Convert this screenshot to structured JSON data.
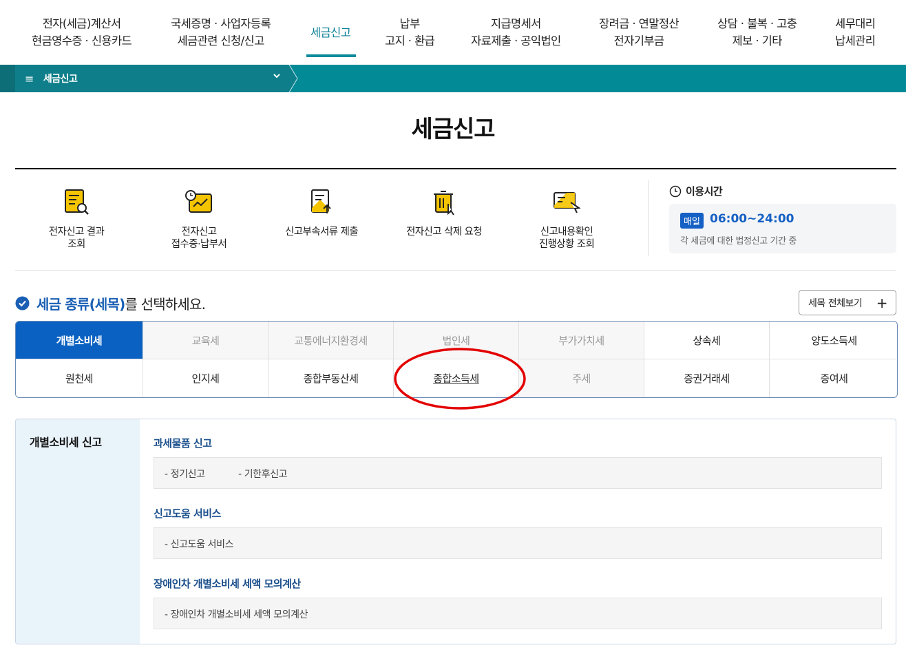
{
  "nav": [
    {
      "line1": "전자(세금)계산서",
      "line2": "현금영수증 · 신용카드"
    },
    {
      "line1": "국세증명 · 사업자등록",
      "line2": "세금관련 신청/신고"
    },
    {
      "line1": "세금신고",
      "line2": ""
    },
    {
      "line1": "납부",
      "line2": "고지 · 환급"
    },
    {
      "line1": "지급명세서",
      "line2": "자료제출 · 공익법인"
    },
    {
      "line1": "장려금 · 연말정산",
      "line2": "전자기부금"
    },
    {
      "line1": "상담 · 불복 · 고충",
      "line2": "제보 · 기타"
    },
    {
      "line1": "세무대리",
      "line2": "납세관리"
    }
  ],
  "breadcrumb": {
    "menu_label": "세금신고"
  },
  "page_title": "세금신고",
  "quick_menu": [
    {
      "line1": "전자신고 결과",
      "line2": "조회"
    },
    {
      "line1": "전자신고",
      "line2": "접수증·납부서"
    },
    {
      "line1": "신고부속서류 제출",
      "line2": ""
    },
    {
      "line1": "전자신고 삭제 요청",
      "line2": ""
    },
    {
      "line1": "신고내용확인",
      "line2": "진행상황 조회"
    }
  ],
  "hours": {
    "title": "이용시간",
    "badge": "매일",
    "time": "06:00~24:00",
    "note": "각 세금에 대한 법정신고 기간 중"
  },
  "select": {
    "heading_blue": "세금 종류(세목)",
    "heading_rest": "를 선택하세요.",
    "view_all": "세목 전체보기"
  },
  "tax_row1": [
    "개별소비세",
    "교육세",
    "교통에너지환경세",
    "법인세",
    "부가가치세",
    "상속세",
    "양도소득세"
  ],
  "tax_row2": [
    "원천세",
    "인지세",
    "종합부동산세",
    "종합소득세",
    "주세",
    "증권거래세",
    "증여세"
  ],
  "detail": {
    "title": "개별소비세 신고",
    "groups": [
      {
        "title": "과세물품 신고",
        "links": [
          "- 정기신고",
          "- 기한후신고"
        ]
      },
      {
        "title": "신고도움 서비스",
        "links": [
          "- 신고도움 서비스"
        ]
      },
      {
        "title": "장애인차 개별소비세 세액 모의계산",
        "links": [
          "- 장애인차 개별소비세 세액 모의계산"
        ]
      }
    ]
  },
  "colors": {
    "teal": "#028a96",
    "active_blue": "#0a61c2",
    "annotation_red": "#e30000"
  }
}
